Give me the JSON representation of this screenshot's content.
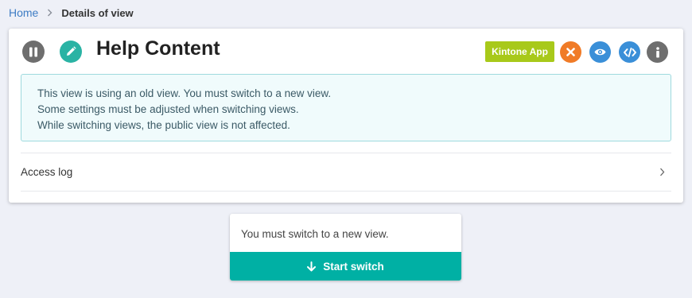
{
  "breadcrumb": {
    "home": "Home",
    "current": "Details of view"
  },
  "view": {
    "title": "Help Content",
    "kintone_label": "Kintone App"
  },
  "notice": {
    "line1": "This view is using an old view. You must switch to a new view.",
    "line2": "Some settings must be adjusted when switching views.",
    "line3": "While switching views, the public view is not affected."
  },
  "access_log": {
    "label": "Access log"
  },
  "switch": {
    "message": "You must switch to a new view.",
    "button_label": "Start switch"
  },
  "icons": {
    "pause": "pause-icon",
    "edit": "pencil-icon",
    "close": "close-icon",
    "preview": "eye-icon",
    "embed": "code-icon",
    "info": "info-icon",
    "chevron": "chevron-right-icon",
    "arrow": "arrow-down-icon"
  },
  "colors": {
    "link": "#3d7cc4",
    "teal": "#00b0a4",
    "kintone": "#a8c91a",
    "orange": "#f07b27",
    "blue": "#3a8fd8",
    "gray": "#6e6e6e"
  }
}
